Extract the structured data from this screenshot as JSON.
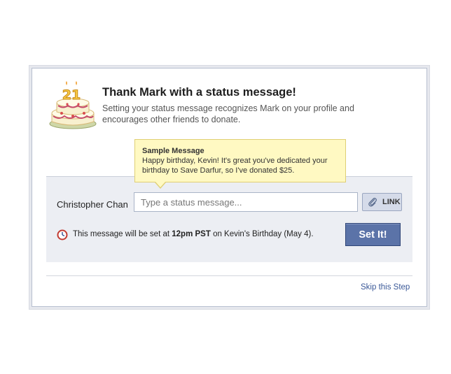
{
  "dialog": {
    "title": "Thank Mark with a status message!",
    "subtitle": "Setting your status message recognizes Mark on your profile and encourages other friends to donate.",
    "cake_number": "21",
    "icons": {
      "header": "birthday-cake-icon",
      "attach": "paperclip-icon",
      "schedule": "clock-icon"
    }
  },
  "tooltip": {
    "title": "Sample Message",
    "body": "Happy birthday, Kevin! It's great you've dedicated your birthday to Save Darfur, so I've donated $25."
  },
  "form": {
    "user_name": "Christopher Chan",
    "status_placeholder": "Type a status message...",
    "status_value": "",
    "link_label": "LINK",
    "schedule_prefix": "This message will be set at ",
    "schedule_time": "12pm PST",
    "schedule_suffix": " on Kevin's Birthday (May 4).",
    "submit_label": "Set It!"
  },
  "footer": {
    "skip_label": "Skip this Step"
  },
  "colors": {
    "accent": "#5b73a8",
    "link": "#3b5998",
    "tooltip_bg": "#fff9c2",
    "panel_bg": "#eceef3"
  }
}
